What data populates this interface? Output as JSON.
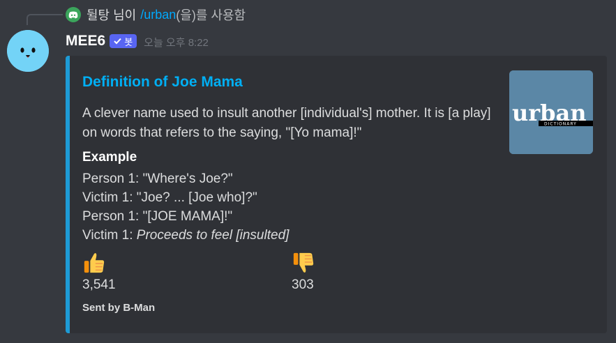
{
  "command": {
    "user": "뒬탕 님이",
    "command_name": "/urban",
    "suffix": "(을)를 사용함"
  },
  "message": {
    "author": "MEE6",
    "bot_tag": "봇",
    "timestamp": "오늘 오후 8:22"
  },
  "embed": {
    "accent_color": "#1d9bd6",
    "title": "Definition of Joe Mama",
    "description": "A clever name used to insult another [individual's] mother. It is [a play] on words that refers to the saying, \"[Yo mama]!\"",
    "field_name": "Example",
    "example_lines": [
      "Person 1: \"Where's Joe?\"",
      "Victim 1: \"Joe? ... [Joe who]?\"",
      "Person 1: \"[JOE MAMA]!\"",
      "Victim 1: "
    ],
    "example_italic": "Proceeds to feel [insulted]",
    "thumbs_up_icon": "thumbs-up-icon",
    "thumbs_up_count": "3,541",
    "thumbs_down_icon": "thumbs-down-icon",
    "thumbs_down_count": "303",
    "footer": "Sent by B-Man",
    "thumbnail": {
      "logo_text": "urban",
      "logo_sub": "DICTIONARY",
      "bg_color": "#5b87a6"
    }
  }
}
